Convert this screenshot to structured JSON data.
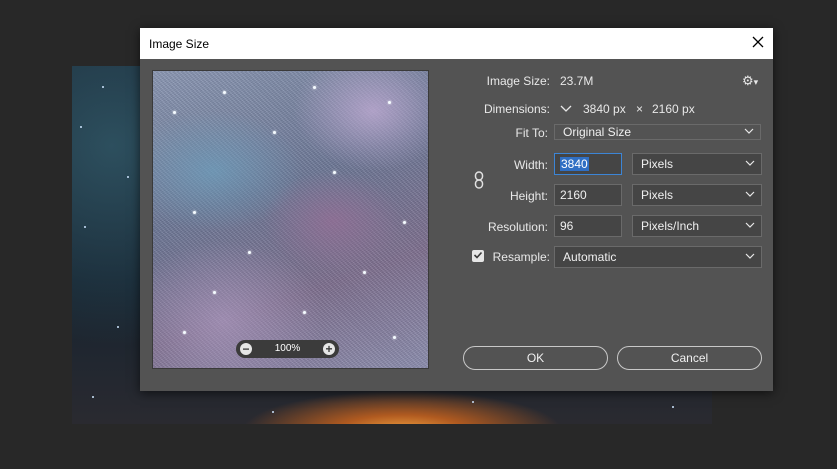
{
  "dialog": {
    "title": "Image Size",
    "close_glyph": "✕"
  },
  "preview": {
    "zoom": "100%",
    "zoom_out_glyph": "−",
    "zoom_in_glyph": "+"
  },
  "info": {
    "image_size_label": "Image Size:",
    "image_size_value": "23.7M",
    "gear_glyph": "⚙",
    "dimensions_label": "Dimensions:",
    "dimensions_width": "3840 px",
    "dimensions_times": "×",
    "dimensions_height": "2160 px"
  },
  "fit_to": {
    "label": "Fit To:",
    "value": "Original Size"
  },
  "width": {
    "label": "Width:",
    "value": "3840",
    "unit": "Pixels"
  },
  "height": {
    "label": "Height:",
    "value": "2160",
    "unit": "Pixels"
  },
  "resolution": {
    "label": "Resolution:",
    "value": "96",
    "unit": "Pixels/Inch"
  },
  "resample": {
    "label": "Resample:",
    "value": "Automatic",
    "checked": true
  },
  "buttons": {
    "ok": "OK",
    "cancel": "Cancel"
  },
  "icons": {
    "chain": "chain-link-icon",
    "gear": "gear-icon",
    "close": "close-icon",
    "chevron": "chevron-down-icon",
    "check": "check-icon"
  }
}
